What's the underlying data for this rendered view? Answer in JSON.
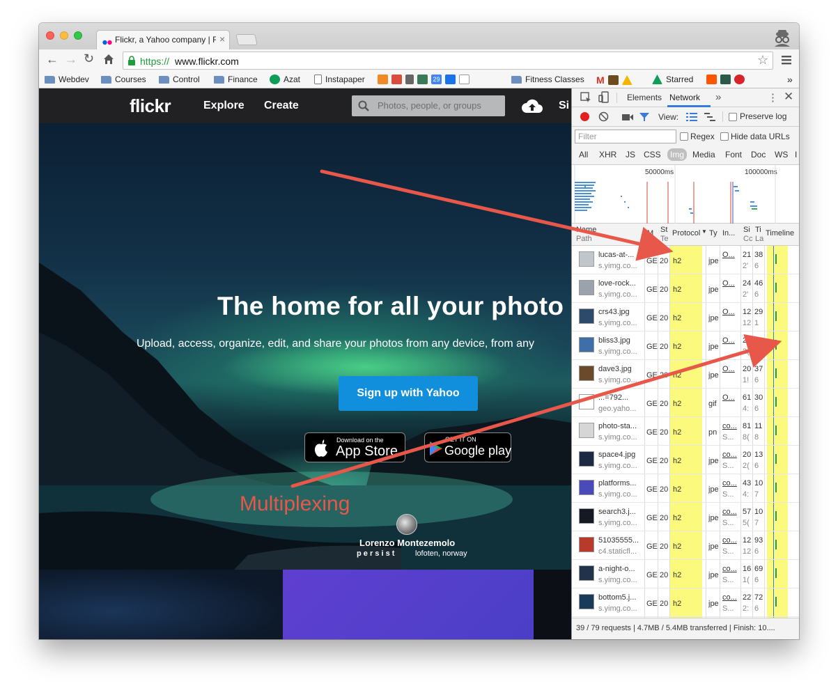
{
  "browser": {
    "tab_title": "Flickr, a Yahoo company | F",
    "url_scheme": "https://",
    "url_host": "www.flickr.com",
    "bookmarks": [
      "Webdev",
      "Courses",
      "Control",
      "Finance",
      "Azat",
      "Instapaper",
      "Fitness Classes",
      "Starred"
    ],
    "calendar_day": "29",
    "overflow": "»"
  },
  "flickr": {
    "logo": "flickr",
    "nav": {
      "explore": "Explore",
      "create": "Create",
      "signin": "Si"
    },
    "search_placeholder": "Photos, people, or groups",
    "headline": "The home for all your photo",
    "subheadline": "Upload, access, organize, edit, and share your photos from any device, from any",
    "signup_button": "Sign up with Yahoo",
    "appstore": {
      "small": "Download on the",
      "big": "App Store"
    },
    "googleplay": {
      "small": "GET IT ON",
      "big": "Google play"
    },
    "credit": {
      "name": "Lorenzo Montezemolo",
      "org": "p e r s i s t",
      "place": "lofoten, norway"
    }
  },
  "annotation": {
    "label": "Multiplexing",
    "color": "#e8584a"
  },
  "devtools": {
    "tabs": {
      "elements": "Elements",
      "network": "Network",
      "more": "»"
    },
    "view_label": "View:",
    "preserve_log": "Preserve log",
    "filter_placeholder": "Filter",
    "regex": "Regex",
    "hide_data_urls": "Hide data URLs",
    "types": [
      "All",
      "XHR",
      "JS",
      "CSS",
      "Img",
      "Media",
      "Font",
      "Doc",
      "WS",
      "I"
    ],
    "active_type": "Img",
    "overview_ticks": [
      "50000ms",
      "100000ms"
    ],
    "columns": {
      "name": "Name",
      "path": "Path",
      "method": "M",
      "status": "St",
      "status2": "Te",
      "protocol": "Protocol",
      "type": "Ty",
      "initiator": "In...",
      "size": "Si",
      "size2": "Cc",
      "time": "Ti",
      "time2": "La",
      "timeline": "Timeline"
    },
    "requests": [
      {
        "name": "lucas-at-...",
        "path": "s.yimg.co...",
        "method": "GE",
        "status": "20",
        "protocol": "h2",
        "type": "jpe",
        "initiator": "O...",
        "initiator_sub": "",
        "size": "21",
        "size2": "2'",
        "time": "38",
        "time2": "6",
        "thumb": "#bfc6cc"
      },
      {
        "name": "love-rock...",
        "path": "s.yimg.co...",
        "method": "GE",
        "status": "20",
        "protocol": "h2",
        "type": "jpe",
        "initiator": "O...",
        "initiator_sub": "",
        "size": "24",
        "size2": "2'",
        "time": "46",
        "time2": "6",
        "thumb": "#9aa3ab"
      },
      {
        "name": "crs43.jpg",
        "path": "s.yimg.co...",
        "method": "GE",
        "status": "20",
        "protocol": "h2",
        "type": "jpe",
        "initiator": "O...",
        "initiator_sub": "",
        "size": "12",
        "size2": "12",
        "time": "29",
        "time2": "1",
        "thumb": "#2d4a6a"
      },
      {
        "name": "bliss3.jpg",
        "path": "s.yimg.co...",
        "method": "GE",
        "status": "20",
        "protocol": "h2",
        "type": "jpe",
        "initiator": "O...",
        "initiator_sub": "",
        "size": "20",
        "size2": "2(",
        "time": "53",
        "time2": "6",
        "thumb": "#3f6fa8"
      },
      {
        "name": "dave3.jpg",
        "path": "s.yimg.co...",
        "method": "GE",
        "status": "20",
        "protocol": "h2",
        "type": "jpe",
        "initiator": "O...",
        "initiator_sub": "",
        "size": "20",
        "size2": "1!",
        "time": "37",
        "time2": "6",
        "thumb": "#6a4a2a"
      },
      {
        "name": "...=792...",
        "path": "geo.yaho...",
        "method": "GE",
        "status": "20",
        "protocol": "h2",
        "type": "gif",
        "initiator": "O...",
        "initiator_sub": "",
        "size": "61",
        "size2": "4:",
        "time": "30",
        "time2": "6",
        "thumb": "#ffffff"
      },
      {
        "name": "photo-sta...",
        "path": "s.yimg.co...",
        "method": "GE",
        "status": "20",
        "protocol": "h2",
        "type": "pn",
        "initiator": "co...",
        "initiator_sub": "S...",
        "size": "81",
        "size2": "8(",
        "time": "11",
        "time2": "8",
        "thumb": "#d6d6d6"
      },
      {
        "name": "space4.jpg",
        "path": "s.yimg.co...",
        "method": "GE",
        "status": "20",
        "protocol": "h2",
        "type": "jpe",
        "initiator": "co...",
        "initiator_sub": "S...",
        "size": "20",
        "size2": "2(",
        "time": "13",
        "time2": "6",
        "thumb": "#1d2a44"
      },
      {
        "name": "platforms...",
        "path": "s.yimg.co...",
        "method": "GE",
        "status": "20",
        "protocol": "h2",
        "type": "jpe",
        "initiator": "co...",
        "initiator_sub": "S...",
        "size": "43",
        "size2": "4:",
        "time": "10",
        "time2": "7",
        "thumb": "#4a4ab8"
      },
      {
        "name": "search3.j...",
        "path": "s.yimg.co...",
        "method": "GE",
        "status": "20",
        "protocol": "h2",
        "type": "jpe",
        "initiator": "co...",
        "initiator_sub": "S...",
        "size": "57",
        "size2": "5(",
        "time": "10",
        "time2": "7",
        "thumb": "#151a22"
      },
      {
        "name": "51035555...",
        "path": "c4.staticfl...",
        "method": "GE",
        "status": "20",
        "protocol": "h2",
        "type": "jpe",
        "initiator": "co...",
        "initiator_sub": "S...",
        "size": "12",
        "size2": "12",
        "time": "93",
        "time2": "6",
        "thumb": "#b83a2a"
      },
      {
        "name": "a-night-o...",
        "path": "s.yimg.co...",
        "method": "GE",
        "status": "20",
        "protocol": "h2",
        "type": "jpe",
        "initiator": "co...",
        "initiator_sub": "S...",
        "size": "16",
        "size2": "1(",
        "time": "69",
        "time2": "6",
        "thumb": "#22324a"
      },
      {
        "name": "bottom5.j...",
        "path": "s.yimg.co...",
        "method": "GE",
        "status": "20",
        "protocol": "h2",
        "type": "jpe",
        "initiator": "co...",
        "initiator_sub": "S...",
        "size": "22",
        "size2": "2:",
        "time": "72",
        "time2": "6",
        "thumb": "#1a3a5a"
      }
    ],
    "status_text": "39 / 79 requests | 4.7MB / 5.4MB transferred | Finish: 10...."
  }
}
